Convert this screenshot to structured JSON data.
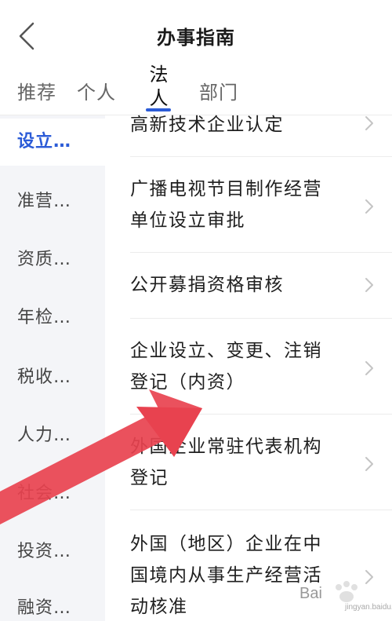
{
  "header": {
    "title": "办事指南"
  },
  "tabs": [
    {
      "label": "推荐"
    },
    {
      "label": "个人"
    },
    {
      "label": "法人"
    },
    {
      "label": "部门"
    }
  ],
  "sidebar": {
    "items": [
      {
        "label": "设立…"
      },
      {
        "label": "准营…"
      },
      {
        "label": "资质…"
      },
      {
        "label": "年检…"
      },
      {
        "label": "税收…"
      },
      {
        "label": "人力…"
      },
      {
        "label": "社会…"
      },
      {
        "label": "投资…"
      },
      {
        "label": "融资…"
      }
    ]
  },
  "list": {
    "items": [
      {
        "line1": "高新技术企业认定",
        "line2": "",
        "line3": ""
      },
      {
        "line1": "广播电视节目制作经营",
        "line2": "单位设立审批",
        "line3": ""
      },
      {
        "line1": "公开募捐资格审核",
        "line2": "",
        "line3": ""
      },
      {
        "line1": "企业设立、变更、注销",
        "line2": "登记（内资）",
        "line3": ""
      },
      {
        "line1": "外国企业常驻代表机构",
        "line2": "登记",
        "line3": ""
      },
      {
        "line1": "外国（地区）企业在中",
        "line2": "国境内从事生产经营活",
        "line3": "动核准"
      }
    ]
  },
  "colors": {
    "accent": "#2b5bd7",
    "arrow": "#e8424f",
    "sidebar_bg": "#f4f5f8"
  },
  "watermark": {
    "text": "Bai",
    "sub": "jingyan.baidu.com"
  }
}
